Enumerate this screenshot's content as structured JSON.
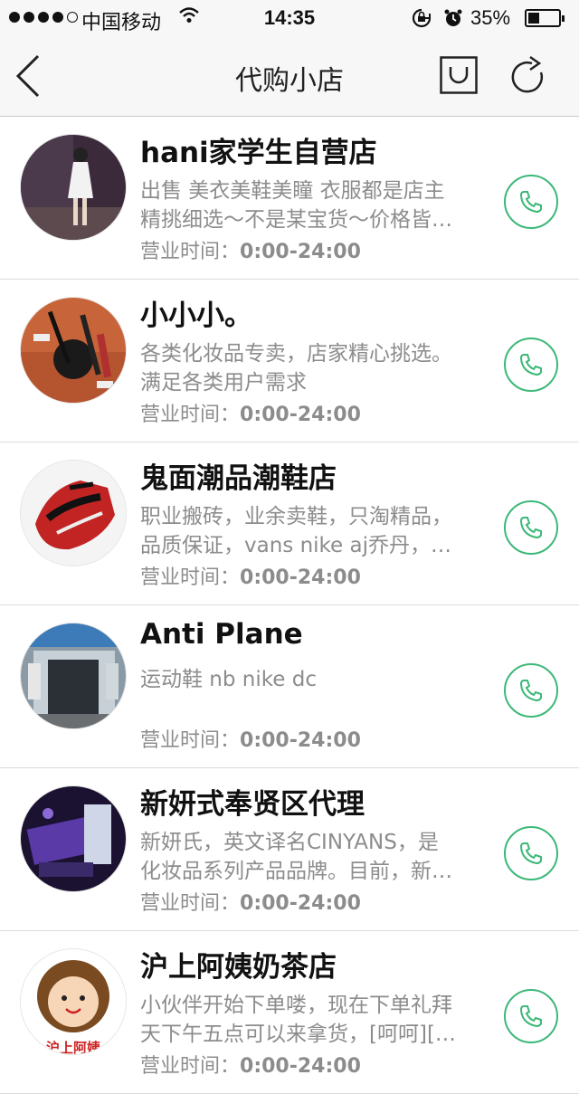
{
  "status_bar": {
    "carrier": "中国移动",
    "time": "14:35",
    "battery": "35%"
  },
  "nav": {
    "title": "代购小店",
    "back_icon": "chevron-left-icon",
    "bag_icon": "shopping-bag-icon",
    "refresh_icon": "refresh-icon"
  },
  "accent_color": "#3cb878",
  "shops": [
    {
      "name": "hani家学生自营店",
      "desc1": "出售 美衣美鞋美瞳 衣服都是店主",
      "desc2": "精挑细选～不是某宝货～价格皆…",
      "hours_label": "营业时间：",
      "hours": "0:00-24:00"
    },
    {
      "name": "小小小。",
      "desc1": "各类化妆品专卖，店家精心挑选。",
      "desc2": "满足各类用户需求",
      "hours_label": "营业时间：",
      "hours": "0:00-24:00"
    },
    {
      "name": "鬼面潮品潮鞋店",
      "desc1": "职业搬砖，业余卖鞋，只淘精品，",
      "desc2": "品质保证，vans nike aj乔丹，…",
      "hours_label": "营业时间：",
      "hours": "0:00-24:00"
    },
    {
      "name": "Anti Plane",
      "desc1": "运动鞋 nb nike dc",
      "desc2": "",
      "hours_label": "营业时间：",
      "hours": "0:00-24:00"
    },
    {
      "name": "新妍式奉贤区代理",
      "desc1": "新妍氏，英文译名CINYANS，是",
      "desc2": "化妆品系列产品品牌。目前，新…",
      "hours_label": "营业时间：",
      "hours": "0:00-24:00"
    },
    {
      "name": "沪上阿姨奶茶店",
      "desc1": "小伙伴开始下单喽，现在下单礼拜",
      "desc2": "天下午五点可以来拿货，[呵呵][…",
      "hours_label": "营业时间：",
      "hours": "0:00-24:00",
      "logo_text": "沪上阿姨"
    }
  ]
}
